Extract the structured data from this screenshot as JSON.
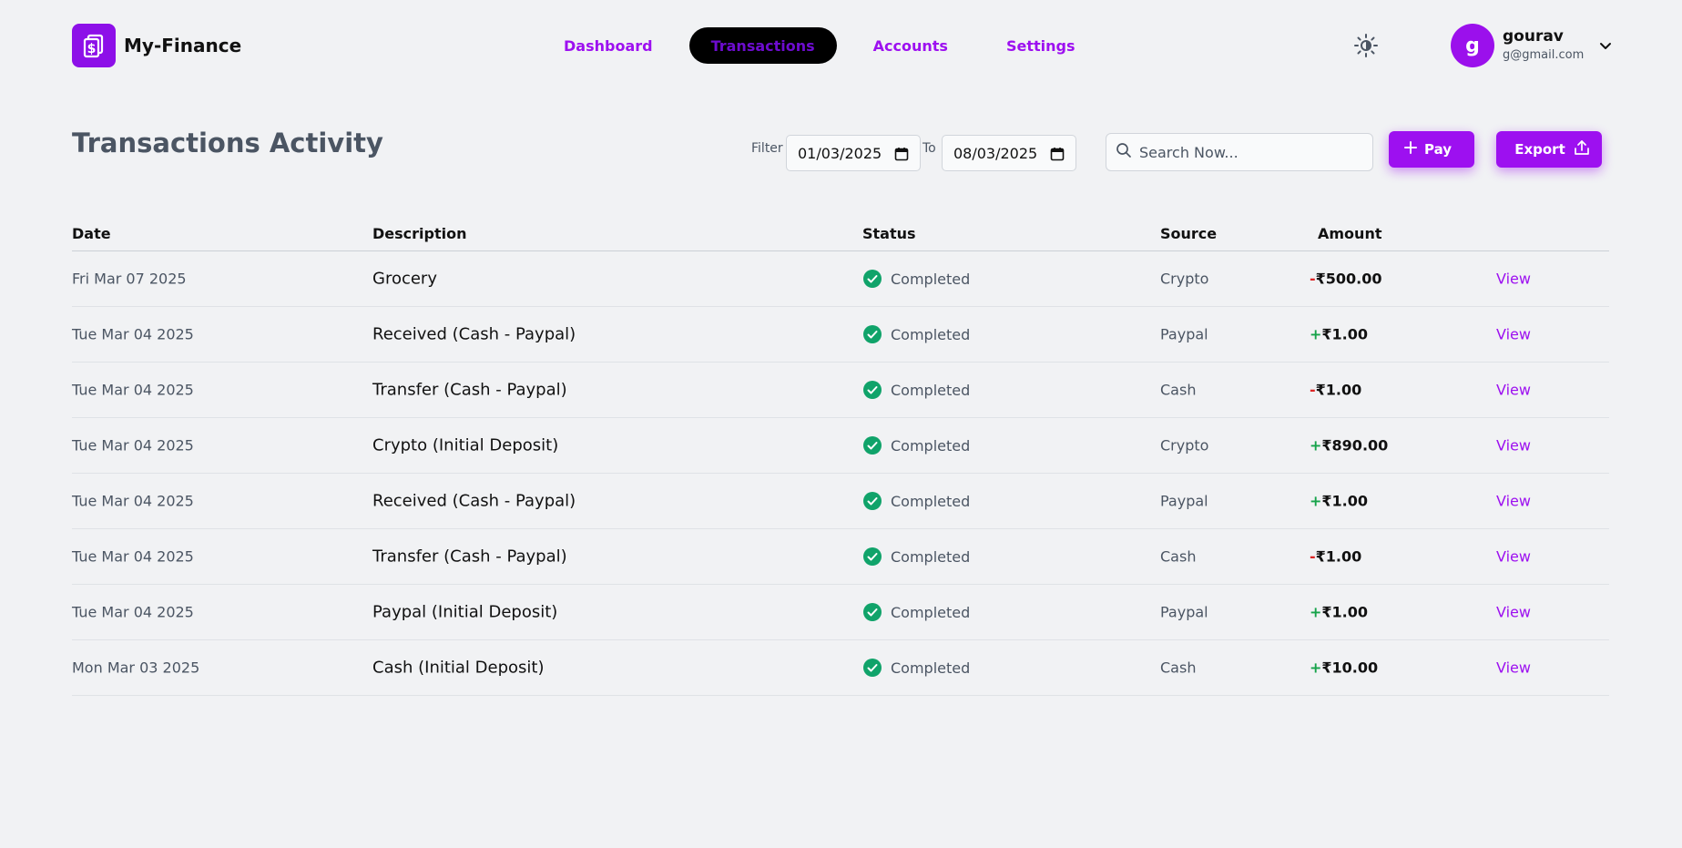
{
  "app": {
    "name": "My-Finance"
  },
  "nav": {
    "items": [
      {
        "label": "Dashboard"
      },
      {
        "label": "Transactions"
      },
      {
        "label": "Accounts"
      },
      {
        "label": "Settings"
      }
    ]
  },
  "user": {
    "initial": "g",
    "name": "gourav",
    "email": "g@gmail.com"
  },
  "page": {
    "title": "Transactions Activity"
  },
  "filters": {
    "filter_label": "Filter",
    "from_date": "01/03/2025",
    "to_label": "To",
    "to_date": "08/03/2025",
    "search_placeholder": "Search Now...",
    "pay_label": "Pay",
    "export_label": "Export"
  },
  "table": {
    "headers": {
      "date": "Date",
      "description": "Description",
      "status": "Status",
      "source": "Source",
      "amount": "Amount"
    },
    "rows": [
      {
        "date": "Fri Mar 07 2025",
        "description": "Grocery",
        "status": "Completed",
        "source": "Crypto",
        "sign": "-",
        "amount": "₹500.00",
        "action": "View"
      },
      {
        "date": "Tue Mar 04 2025",
        "description": "Received (Cash - Paypal)",
        "status": "Completed",
        "source": "Paypal",
        "sign": "+",
        "amount": "₹1.00",
        "action": "View"
      },
      {
        "date": "Tue Mar 04 2025",
        "description": "Transfer (Cash - Paypal)",
        "status": "Completed",
        "source": "Cash",
        "sign": "-",
        "amount": "₹1.00",
        "action": "View"
      },
      {
        "date": "Tue Mar 04 2025",
        "description": "Crypto (Initial Deposit)",
        "status": "Completed",
        "source": "Crypto",
        "sign": "+",
        "amount": "₹890.00",
        "action": "View"
      },
      {
        "date": "Tue Mar 04 2025",
        "description": "Received (Cash - Paypal)",
        "status": "Completed",
        "source": "Paypal",
        "sign": "+",
        "amount": "₹1.00",
        "action": "View"
      },
      {
        "date": "Tue Mar 04 2025",
        "description": "Transfer (Cash - Paypal)",
        "status": "Completed",
        "source": "Cash",
        "sign": "-",
        "amount": "₹1.00",
        "action": "View"
      },
      {
        "date": "Tue Mar 04 2025",
        "description": "Paypal (Initial Deposit)",
        "status": "Completed",
        "source": "Paypal",
        "sign": "+",
        "amount": "₹1.00",
        "action": "View"
      },
      {
        "date": "Mon Mar 03 2025",
        "description": "Cash (Initial Deposit)",
        "status": "Completed",
        "source": "Cash",
        "sign": "+",
        "amount": "₹10.00",
        "action": "View"
      }
    ]
  },
  "colors": {
    "accent": "#9d10f0",
    "positive": "#16a34a",
    "negative": "#dc2626",
    "status_ok": "#10a36a"
  },
  "icons": {
    "logo": "dollar-document-icon",
    "theme": "sun-icon",
    "caret": "chevron-down-icon",
    "calendar": "calendar-icon",
    "search": "search-icon",
    "pay": "plus-icon",
    "export": "upload-icon",
    "status": "check-circle-icon"
  }
}
